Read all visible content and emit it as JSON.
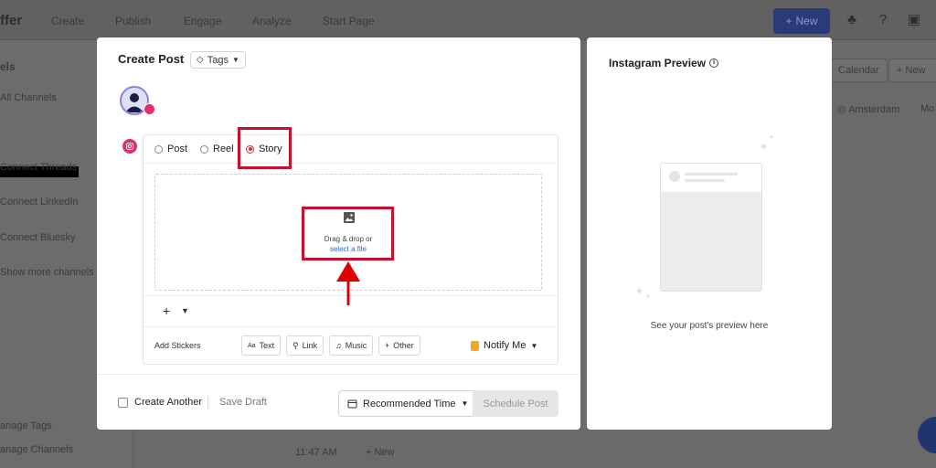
{
  "background": {
    "brand": "ffer",
    "nav": [
      "Create",
      "Publish",
      "Engage",
      "Analyze",
      "Start Page"
    ],
    "new_button": "New",
    "sidebar": {
      "heading": "els",
      "items": [
        "All Channels",
        "Connect Threads",
        "Connect LinkedIn",
        "Connect Bluesky",
        "Show more channels"
      ],
      "bottom_items": [
        "anage Tags",
        "anage Channels"
      ]
    },
    "right_bar": {
      "calendar": "Calendar",
      "new_short": "New",
      "timezone": "Amsterdam",
      "more": "Mo"
    },
    "timeline": {
      "time": "11:47 AM",
      "new": "New"
    }
  },
  "modal": {
    "title": "Create Post",
    "tags_label": "Tags",
    "post_types": [
      {
        "label": "Post",
        "selected": false
      },
      {
        "label": "Reel",
        "selected": false
      },
      {
        "label": "Story",
        "selected": true
      }
    ],
    "dropzone": {
      "text": "Drag & drop or",
      "link": "select a file"
    },
    "stickers_label": "Add Stickers",
    "stickers": [
      {
        "label": "Text",
        "icon": "Aa"
      },
      {
        "label": "Link",
        "icon": "🔗"
      },
      {
        "label": "Music",
        "icon": "♫"
      },
      {
        "label": "Other",
        "icon": "+"
      }
    ],
    "notify_label": "Notify Me",
    "footer": {
      "create_another": "Create Another",
      "save_draft": "Save Draft",
      "recommended_time": "Recommended Time",
      "schedule": "Schedule Post"
    }
  },
  "preview": {
    "title": "Instagram Preview",
    "hint": "See your post's preview here"
  },
  "colors": {
    "accent_red": "#c8102e",
    "instagram": "#e1306c",
    "link": "#2c5fd6"
  }
}
